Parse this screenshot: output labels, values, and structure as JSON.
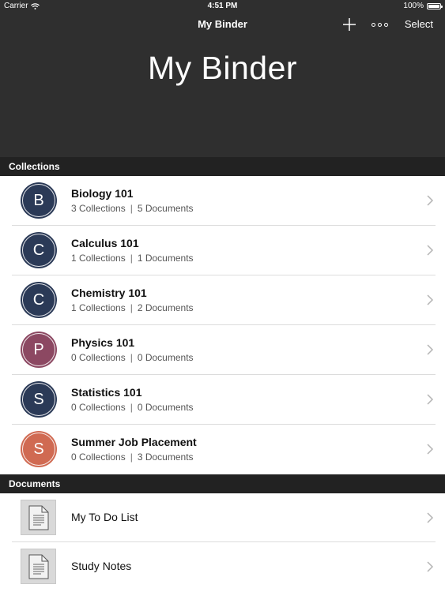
{
  "status_bar": {
    "carrier": "Carrier",
    "time": "4:51 PM",
    "battery": "100%"
  },
  "nav": {
    "title": "My Binder",
    "select_label": "Select",
    "add_icon": "plus-icon",
    "more_icon": "more-dots-icon"
  },
  "hero": {
    "title": "My Binder"
  },
  "collections_header": "Collections",
  "documents_header": "Documents",
  "collections": [
    {
      "letter": "B",
      "title": "Biology 101",
      "collections": "3 Collections",
      "documents": "5 Documents",
      "color": "#2b3a57"
    },
    {
      "letter": "C",
      "title": "Calculus 101",
      "collections": "1 Collections",
      "documents": "1 Documents",
      "color": "#2b3a57"
    },
    {
      "letter": "C",
      "title": "Chemistry 101",
      "collections": "1 Collections",
      "documents": "2 Documents",
      "color": "#2b3a57"
    },
    {
      "letter": "P",
      "title": "Physics 101",
      "collections": "0 Collections",
      "documents": "0 Documents",
      "color": "#8c4862"
    },
    {
      "letter": "S",
      "title": "Statistics 101",
      "collections": "0 Collections",
      "documents": "0 Documents",
      "color": "#2b3a57"
    },
    {
      "letter": "S",
      "title": "Summer Job Placement",
      "collections": "0 Collections",
      "documents": "3 Documents",
      "color": "#d06a52"
    }
  ],
  "documents": [
    {
      "title": "My To Do List",
      "icon": "document-icon"
    },
    {
      "title": "Study Notes",
      "icon": "document-icon"
    }
  ]
}
